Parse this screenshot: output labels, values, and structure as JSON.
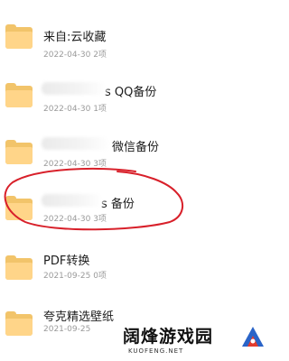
{
  "folders": [
    {
      "name": "来自:云收藏",
      "date": "2022-04-30",
      "count": "2项"
    },
    {
      "name": "s QQ备份",
      "date": "2022-04-30",
      "count": "1项"
    },
    {
      "name": "微信备份",
      "date": "2022-04-30",
      "count": "3项"
    },
    {
      "name": "s 备份",
      "date": "2022-04-30",
      "count": "3项"
    },
    {
      "name": "PDF转换",
      "date": "2021-09-25",
      "count": "0项"
    },
    {
      "name": "夸克精选壁纸",
      "date": "2021-09-25",
      "count": ""
    }
  ],
  "watermark": {
    "logo": "阔烽游戏园",
    "sub": "KUOFENG.NET"
  },
  "colors": {
    "folder": "#ffd589",
    "folder_back": "#f2c46a",
    "annotation": "#d8202a",
    "meta": "#9a9a9a"
  }
}
